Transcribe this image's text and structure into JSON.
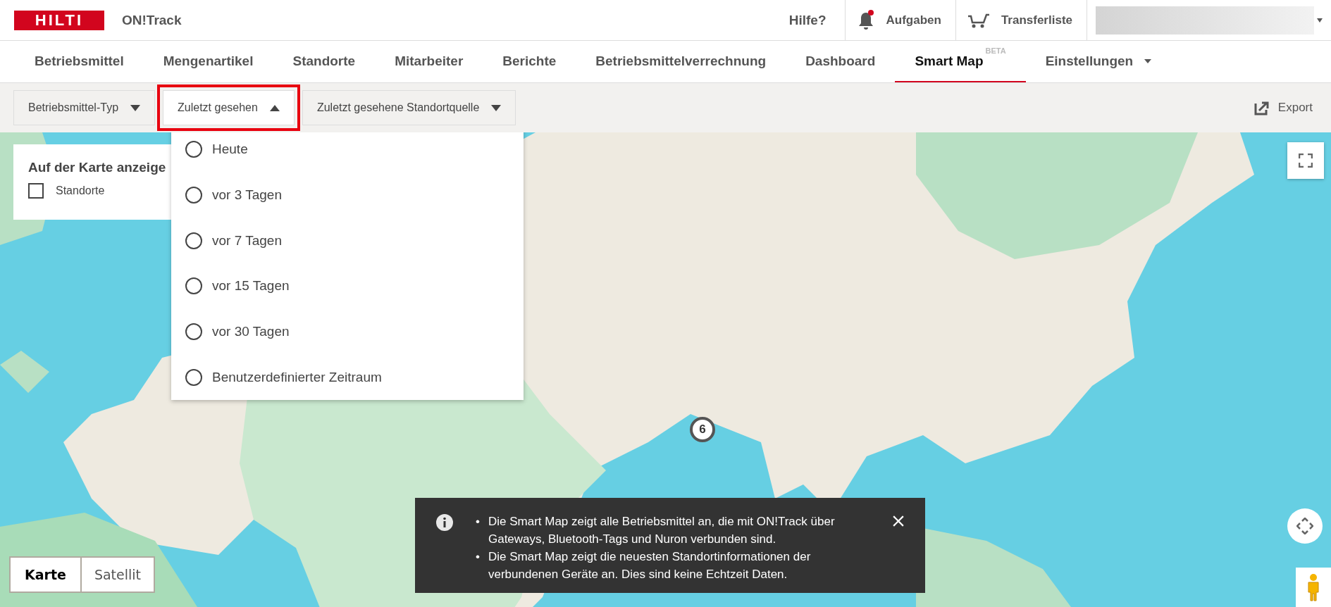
{
  "header": {
    "logo": "HILTI",
    "app_name": "ON!Track",
    "help": "Hilfe?",
    "tasks": {
      "label": "Aufgaben",
      "notification": true
    },
    "transfer": "Transferliste"
  },
  "nav": [
    {
      "label": "Betriebsmittel",
      "selected": false,
      "kind": "link"
    },
    {
      "label": "Mengenartikel",
      "selected": false,
      "kind": "link"
    },
    {
      "label": "Standorte",
      "selected": false,
      "kind": "link"
    },
    {
      "label": "Mitarbeiter",
      "selected": false,
      "kind": "link"
    },
    {
      "label": "Berichte",
      "selected": false,
      "kind": "link"
    },
    {
      "label": "Betriebsmittelverrechnung",
      "selected": false,
      "kind": "link"
    },
    {
      "label": "Dashboard",
      "selected": false,
      "kind": "link"
    },
    {
      "label": "Smart Map",
      "badge": "BETA",
      "selected": true,
      "kind": "link"
    },
    {
      "label": "Einstellungen",
      "selected": false,
      "kind": "menu"
    }
  ],
  "filters": [
    {
      "label": "Betriebsmittel-Typ",
      "expanded": false,
      "highlighted": false
    },
    {
      "label": "Zuletzt gesehen",
      "expanded": true,
      "highlighted": true
    },
    {
      "label": "Zuletzt gesehene Standortquelle",
      "expanded": false,
      "highlighted": false
    }
  ],
  "export": "Export",
  "dropdown": {
    "options": [
      {
        "label": "Heute",
        "selected": false
      },
      {
        "label": "vor 3 Tagen",
        "selected": false
      },
      {
        "label": "vor 7 Tagen",
        "selected": false
      },
      {
        "label": "vor 15 Tagen",
        "selected": false
      },
      {
        "label": "vor 30 Tagen",
        "selected": false
      },
      {
        "label": "Benutzerdefinierter Zeitraum",
        "selected": false
      }
    ]
  },
  "map_panel": {
    "title": "Auf der Karte anzeige",
    "checkbox": {
      "label": "Standorte",
      "checked": false
    }
  },
  "cluster": {
    "count": "6"
  },
  "info": {
    "marker": "•",
    "items": [
      "Die Smart Map zeigt alle Betriebsmittel an, die mit ON!Track über Gateways, Bluetooth-Tags und Nuron verbunden sind.",
      "Die Smart Map zeigt die neuesten Standortinformationen der verbundenen Geräte an. Dies sind keine Echtzeit Daten."
    ]
  },
  "map_types": [
    {
      "label": "Karte",
      "selected": true
    },
    {
      "label": "Satellit",
      "selected": false
    }
  ]
}
